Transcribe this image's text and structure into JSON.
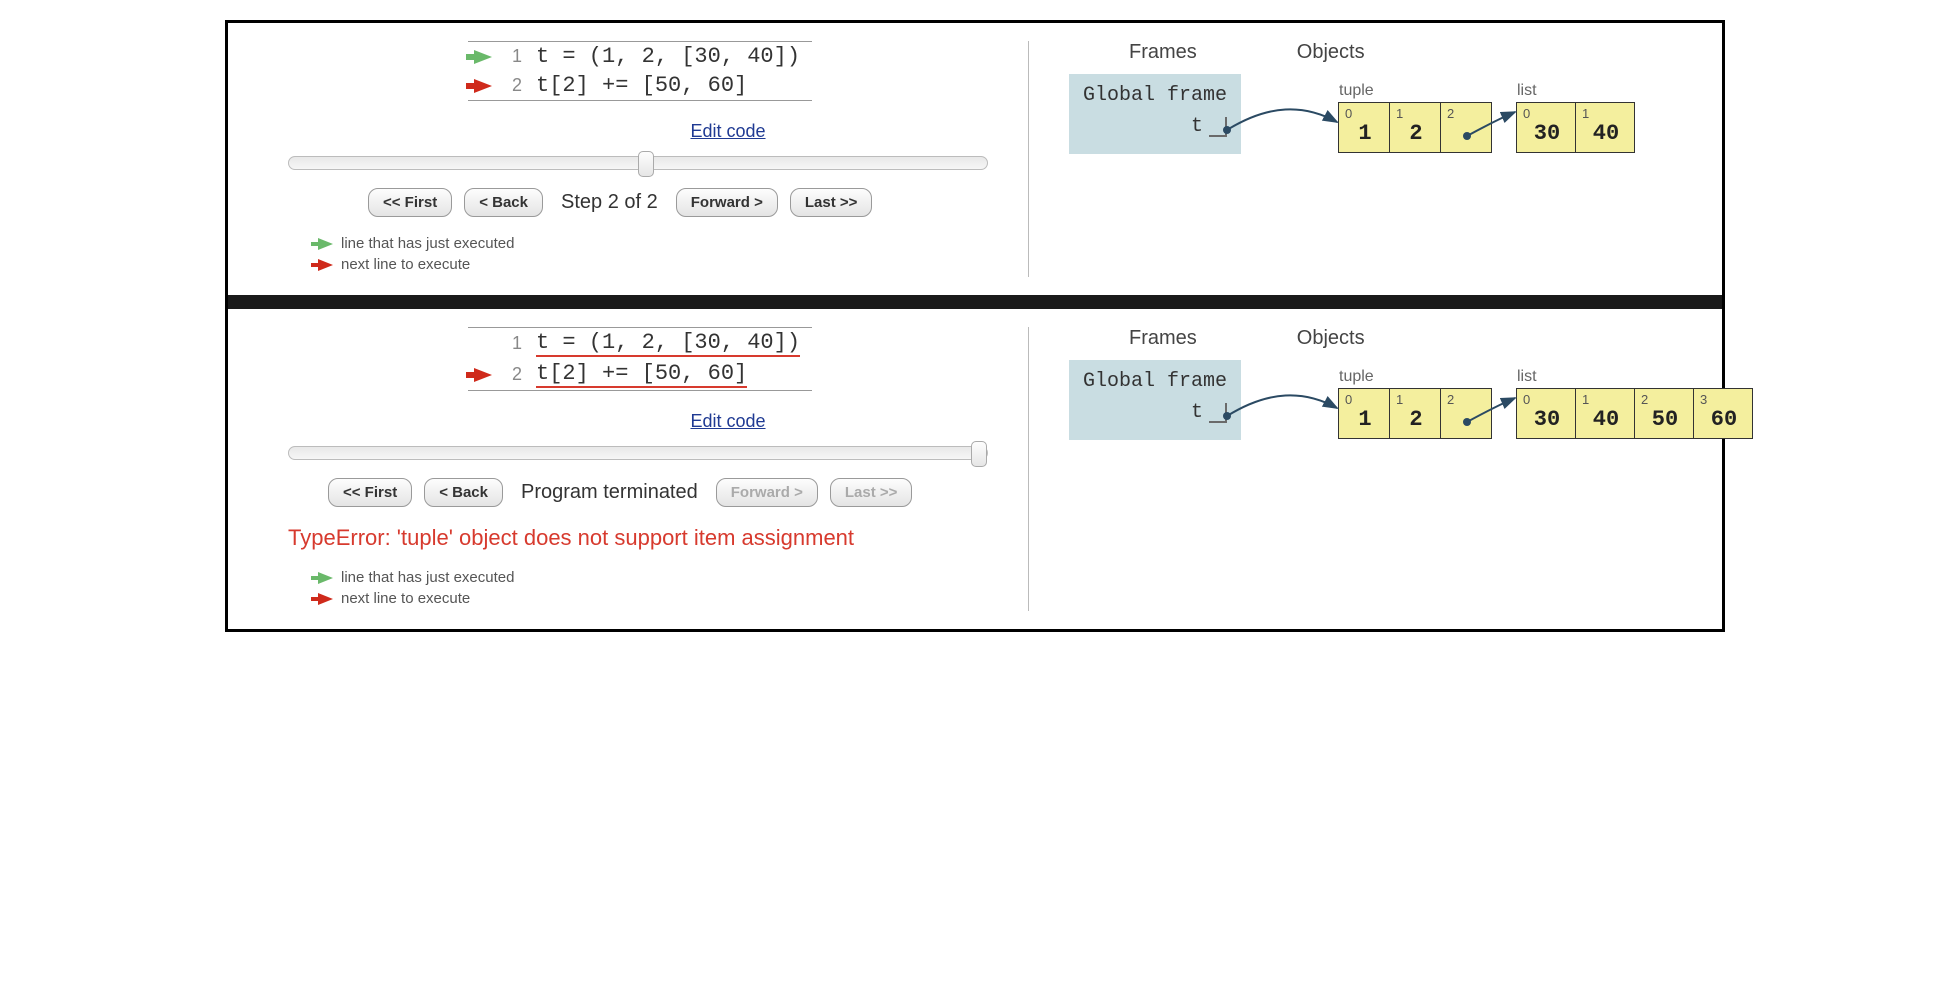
{
  "panel1": {
    "code": {
      "line1_num": "1",
      "line1_text": "t = (1, 2, [30, 40])",
      "line2_num": "2",
      "line2_text": "t[2] += [50, 60]"
    },
    "edit_link": "Edit code",
    "slider_percent": 50,
    "nav": {
      "first": "<< First",
      "back": "< Back",
      "step": "Step 2 of 2",
      "forward": "Forward >",
      "last": "Last >>"
    },
    "legend": {
      "executed": "line that has just executed",
      "next": "next line to execute"
    },
    "viz": {
      "frames_header": "Frames",
      "objects_header": "Objects",
      "global_frame": "Global frame",
      "var_name": "t",
      "tuple_label": "tuple",
      "list_label": "list",
      "tuple_cells": [
        {
          "idx": "0",
          "val": "1"
        },
        {
          "idx": "1",
          "val": "2"
        },
        {
          "idx": "2",
          "val": ""
        }
      ],
      "list_cells": [
        {
          "idx": "0",
          "val": "30"
        },
        {
          "idx": "1",
          "val": "40"
        }
      ]
    }
  },
  "panel2": {
    "code": {
      "line1_num": "1",
      "line1_text": "t = (1, 2, [30, 40])",
      "line2_num": "2",
      "line2_text": "t[2] += [50, 60]"
    },
    "edit_link": "Edit code",
    "slider_percent": 100,
    "nav": {
      "first": "<< First",
      "back": "< Back",
      "step": "Program terminated",
      "forward": "Forward >",
      "last": "Last >>"
    },
    "error": "TypeError: 'tuple' object does not support item assignment",
    "legend": {
      "executed": "line that has just executed",
      "next": "next line to execute"
    },
    "viz": {
      "frames_header": "Frames",
      "objects_header": "Objects",
      "global_frame": "Global frame",
      "var_name": "t",
      "tuple_label": "tuple",
      "list_label": "list",
      "tuple_cells": [
        {
          "idx": "0",
          "val": "1"
        },
        {
          "idx": "1",
          "val": "2"
        },
        {
          "idx": "2",
          "val": ""
        }
      ],
      "list_cells": [
        {
          "idx": "0",
          "val": "30"
        },
        {
          "idx": "1",
          "val": "40"
        },
        {
          "idx": "2",
          "val": "50"
        },
        {
          "idx": "3",
          "val": "60"
        }
      ]
    }
  }
}
